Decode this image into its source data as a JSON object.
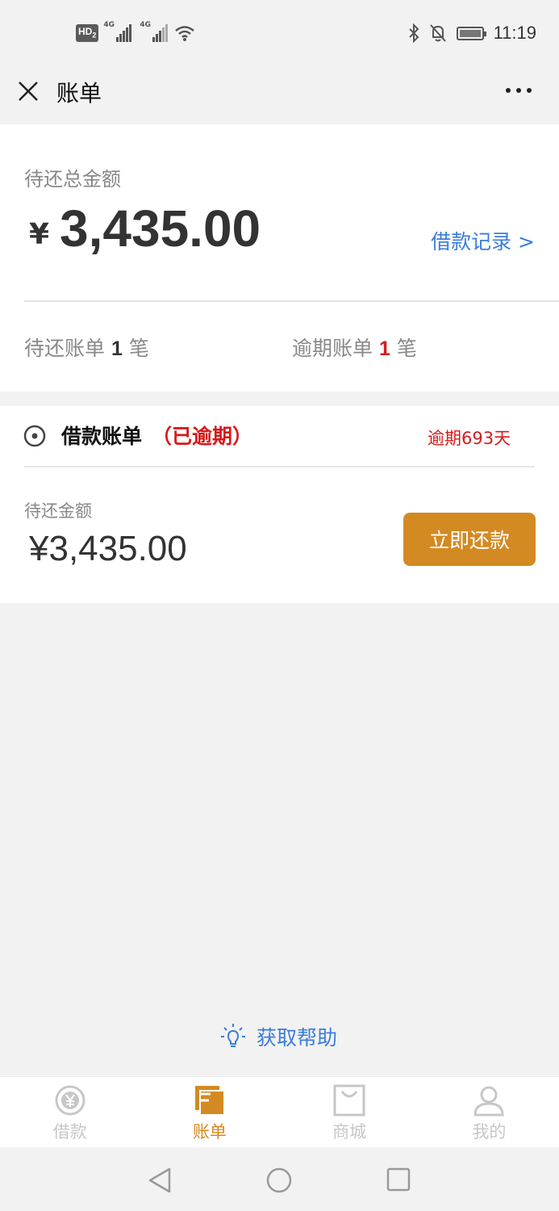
{
  "status_bar": {
    "hd_label": "HD",
    "sim_badge": "2",
    "network_1": "4G",
    "network_2": "4G",
    "time": "11:19"
  },
  "header": {
    "title": "账单"
  },
  "summary": {
    "total_label": "待还总金额",
    "currency": "¥",
    "total_amount": "3,435.00",
    "loan_record_link": "借款记录 >",
    "pending_prefix": "待还账单",
    "pending_count": "1",
    "pending_suffix": "笔",
    "overdue_prefix": "逾期账单",
    "overdue_count": "1",
    "overdue_suffix": "笔"
  },
  "bill": {
    "title": "借款账单",
    "status": "（已逾期）",
    "overdue_days": "逾期693天",
    "due_label": "待还金额",
    "due_amount": "¥3,435.00",
    "pay_button": "立即还款"
  },
  "help": {
    "label": "获取帮助"
  },
  "tabs": [
    {
      "label": "借款",
      "icon": "yen-circle-icon",
      "active": false
    },
    {
      "label": "账单",
      "icon": "bill-icon",
      "active": true
    },
    {
      "label": "商城",
      "icon": "shopping-bag-icon",
      "active": false
    },
    {
      "label": "我的",
      "icon": "person-icon",
      "active": false
    }
  ],
  "colors": {
    "accent": "#d48a22",
    "link": "#3b7dd8",
    "danger": "#d51b1b",
    "background": "#f2f2f2"
  }
}
